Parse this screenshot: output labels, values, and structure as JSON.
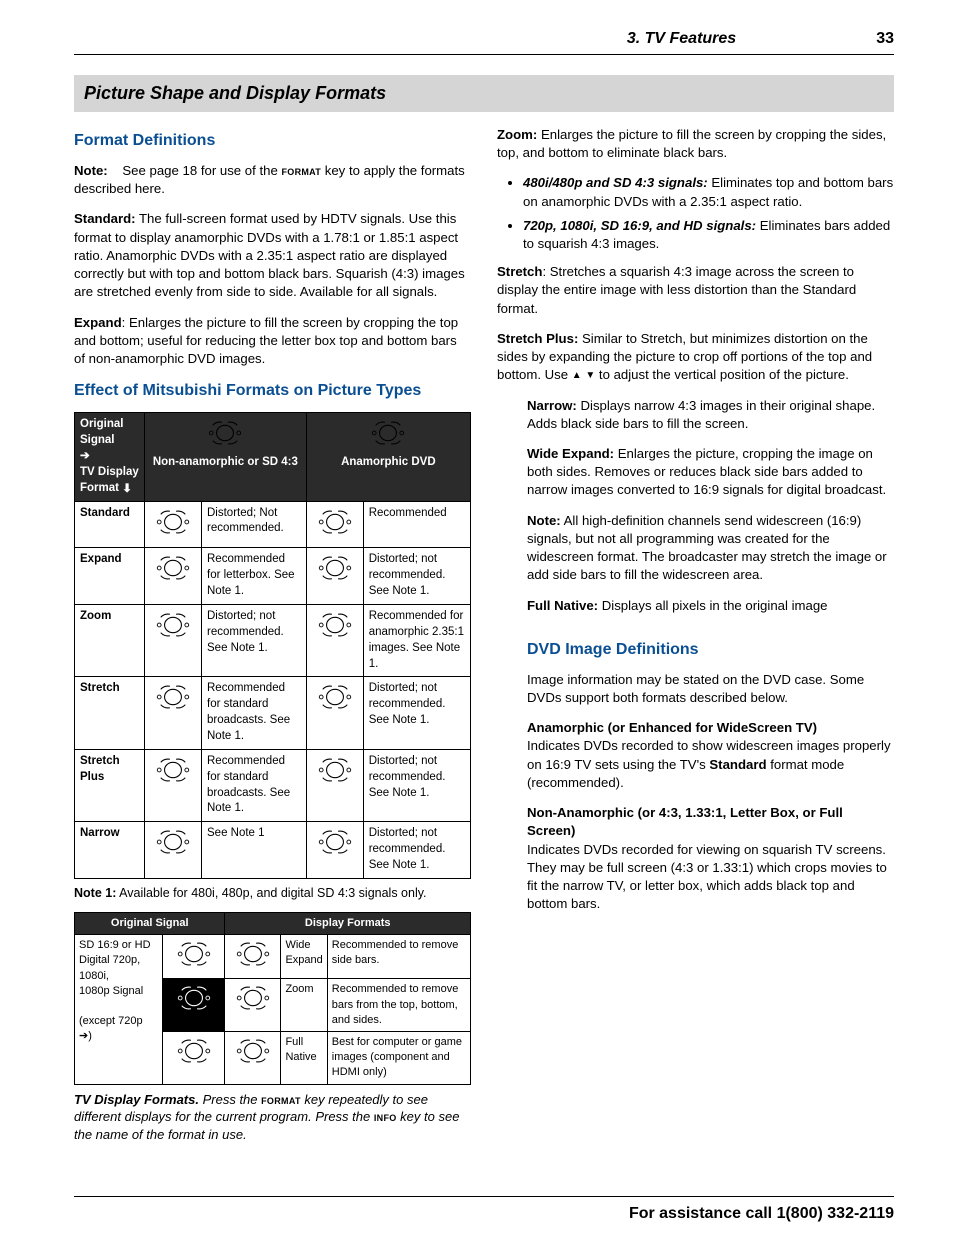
{
  "header": {
    "chapter": "3.  TV Features",
    "page": "33"
  },
  "banner": "Picture Shape and Display Formats",
  "left": {
    "h_formats": "Format Definitions",
    "note_label": "Note:",
    "note_text": "See page 18 for use of the ",
    "note_key": "format",
    "note_tail": " key to apply the formats described here.",
    "std_label": "Standard:",
    "std_text": "  The full-screen format used by HDTV signals.  Use this format to display anamorphic DVDs with a 1.78:1 or 1.85:1 aspect ratio.  Anamorphic DVDs with a 2.35:1 aspect ratio are displayed correctly but with top and bottom black bars.  Squarish (4:3) images are stretched evenly from side to side.  Available for all signals.",
    "exp_label": "Expand",
    "exp_text": ":  Enlarges the picture to fill the screen by cropping the top and bottom; useful for reducing the letter box top and bottom bars of non-anamorphic DVD images.",
    "h_effect": "Effect of Mitsubishi Formats on Picture Types",
    "t1_head_left_1": "Original Signal",
    "t1_head_left_2": "TV Display Format",
    "t1_head_mid": "Non-anamorphic or SD 4:3",
    "t1_head_right": "Anamorphic DVD",
    "t1_rows": [
      {
        "fmt": "Standard",
        "a": "Distorted;  Not recommended.",
        "b": "Recommended"
      },
      {
        "fmt": "Expand",
        "a": "Recommended for letterbox.  See Note 1.",
        "b": "Distorted; not recommended.  See Note 1."
      },
      {
        "fmt": "Zoom",
        "a": "Distorted; not recommended.  See Note 1.",
        "b": "Recommended for anamorphic 2.35:1 images.  See Note 1."
      },
      {
        "fmt": "Stretch",
        "a": "Recommended for standard broadcasts.  See Note 1.",
        "b": "Distorted; not recommended.  See Note 1."
      },
      {
        "fmt": "Stretch Plus",
        "a": "Recommended for standard broadcasts.  See Note 1.",
        "b": "Distorted; not recommended.  See Note 1."
      },
      {
        "fmt": "Narrow",
        "a": "See Note 1",
        "b": "Distorted; not recommended.  See Note 1."
      }
    ],
    "note1_label": "Note 1:",
    "note1_text": "  Available for 480i, 480p, and digital SD 4:3 signals only.",
    "t2_head_left": "Original Signal",
    "t2_head_right": "Display Formats",
    "t2_r1_sig": "SD 16:9 or HD Digital 720p, 1080i,",
    "t2_r1_fmt": "Wide Expand",
    "t2_r1_txt": "Recommended to remove side bars.",
    "t2_r2_sig": "1080p Signal",
    "t2_r2_fmt": "Zoom",
    "t2_r2_txt": "Recommended to remove bars from the top, bottom, and sides.",
    "t2_r3_sig": "(except  720p",
    "t2_r3_sig_tail": ")",
    "t2_r3_fmt": "Full Native",
    "t2_r3_txt": "Best for computer or game images (component and HDMI only)",
    "caption_lead": "TV Display Formats.",
    "caption_mid": "  Press the ",
    "caption_key1": "format",
    "caption_mid2": " key repeatedly to see different displays for the current program.  Press the ",
    "caption_key2": "info",
    "caption_tail": " key to see the name of the format in use."
  },
  "right": {
    "zoom_label": "Zoom:",
    "zoom_text": "  Enlarges the picture to fill the screen by cropping the sides, top, and bottom to eliminate black bars.",
    "bul1_lead": "480i/480p and SD 4:3 signals:",
    "bul1_text": "  Eliminates top and bottom bars on anamorphic DVDs with a 2.35:1 aspect ratio.",
    "bul2_lead": "720p, 1080i, SD 16:9, and HD signals:",
    "bul2_text": "  Eliminates bars added to squarish 4:3 images.",
    "stretch_label": "Stretch",
    "stretch_text": ":  Stretches a squarish 4:3 image across the screen to display the entire image with less distortion than the Standard format.",
    "splus_label": "Stretch Plus:",
    "splus_text": "  Similar to Stretch, but minimizes distortion on the sides by expanding the picture to crop off portions of the top and bottom.  Use ",
    "splus_tail": " to adjust the vertical position of the picture.",
    "narrow_label": "Narrow:",
    "narrow_text": "  Displays narrow 4:3 images in their original shape.  Adds black side bars to fill the screen.",
    "wexp_label": "Wide Expand:",
    "wexp_text": "  Enlarges the picture, cropping the image on both sides.  Removes or reduces black side bars added to narrow images converted to 16:9 signals for digital broadcast.",
    "rnote_label": "Note:",
    "rnote_text": "  All high-definition channels send widescreen (16:9) signals, but not all programming was created for the widescreen format.  The broadcaster may stretch the image or add side bars to fill the widescreen area.",
    "fnat_label": "Full Native:",
    "fnat_text": "  Displays all pixels in the original image",
    "h_dvd": "DVD Image Definitions",
    "dvd_intro": "Image information may be stated on the DVD case.  Some DVDs support both formats described below.",
    "anam_h": "Anamorphic (or Enhanced for WideScreen TV)",
    "anam_p1": "Indicates DVDs recorded to show widescreen images properly on 16:9 TV sets using the TV's ",
    "anam_std": "Standard",
    "anam_p2": " format mode (recommended).",
    "nonan_h": "Non-Anamorphic (or 4:3, 1.33:1, Letter Box, or Full Screen)",
    "nonan_p": "Indicates DVDs recorded for viewing on squarish TV screens.  They may be full screen (4:3 or 1.33:1) which crops movies to fit the narrow TV, or letter box, which adds black top and bottom bars."
  },
  "footer": "For assistance call 1(800) 332-2119"
}
